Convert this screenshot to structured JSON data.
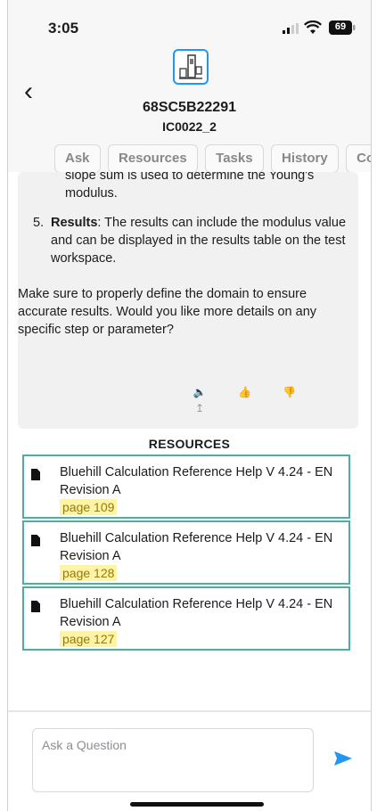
{
  "status_bar": {
    "time": "3:05",
    "battery": "69"
  },
  "header": {
    "device_id": "68SC5B22291",
    "device_sub": "IC0022_2"
  },
  "tabs": [
    "Ask",
    "Resources",
    "Tasks",
    "History",
    "Con"
  ],
  "chat": {
    "fragment": "slope sum is used to determine the Young's modulus.",
    "results_num": "5.",
    "results_bold": "Results",
    "results_text": ": The results can include the modulus value and can be displayed in the results table on the test workspace.",
    "closing": "Make sure to properly define the domain to ensure accurate results. Would you like more details on any specific step or parameter?"
  },
  "resources": {
    "title": "RESOURCES",
    "items": [
      {
        "title": "Bluehill Calculation Reference Help V 4.24 - EN Revision A",
        "page": "page 109"
      },
      {
        "title": "Bluehill Calculation Reference Help V 4.24 - EN Revision A",
        "page": "page 128"
      },
      {
        "title": "Bluehill Calculation Reference Help V 4.24 - EN Revision A",
        "page": "page 127"
      }
    ]
  },
  "input": {
    "placeholder": "Ask a Question"
  },
  "colors": {
    "accent": "#2196f3",
    "resource_border": "#4caf9f",
    "highlight": "#fdf4a8"
  }
}
